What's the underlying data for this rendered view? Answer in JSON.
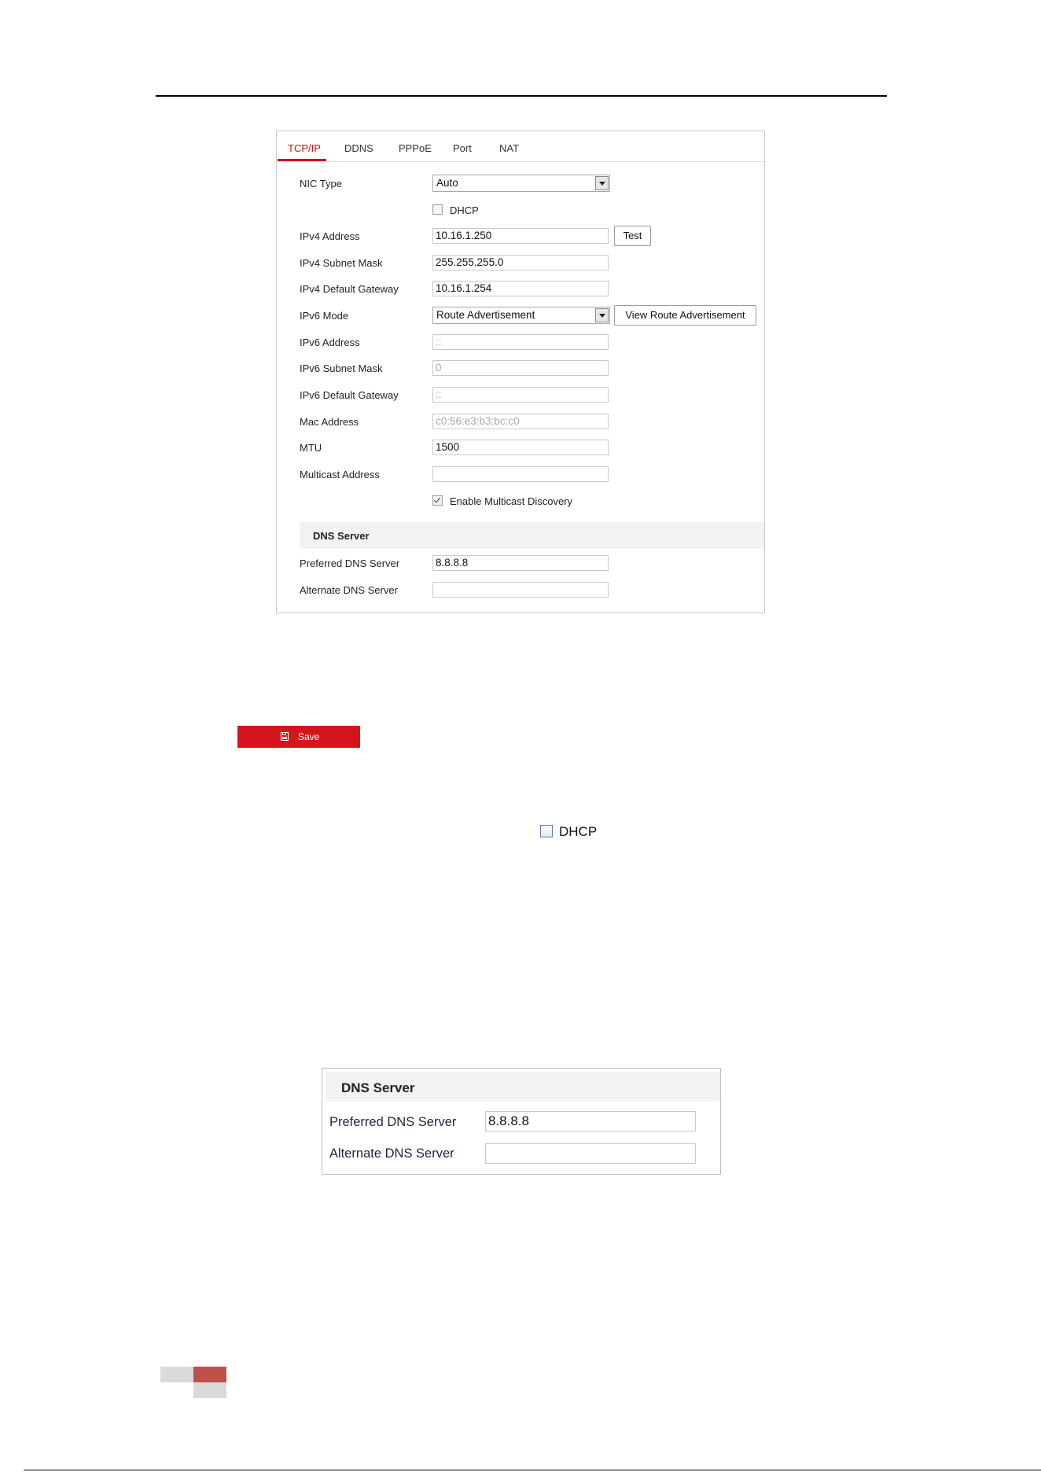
{
  "tabs": [
    "TCP/IP",
    "DDNS",
    "PPPoE",
    "Port",
    "NAT"
  ],
  "form": {
    "nic_type_label": "NIC Type",
    "nic_type_value": "Auto",
    "dhcp_label": "DHCP",
    "ipv4_address_label": "IPv4 Address",
    "ipv4_address_value": "10.16.1.250",
    "test_label": "Test",
    "ipv4_subnet_label": "IPv4 Subnet Mask",
    "ipv4_subnet_value": "255.255.255.0",
    "ipv4_gateway_label": "IPv4 Default Gateway",
    "ipv4_gateway_value": "10.16.1.254",
    "ipv6_mode_label": "IPv6 Mode",
    "ipv6_mode_value": "Route Advertisement",
    "view_route_label": "View Route Advertisement",
    "ipv6_address_label": "IPv6 Address",
    "ipv6_address_value": "::",
    "ipv6_subnet_label": "IPv6 Subnet Mask",
    "ipv6_subnet_value": "0",
    "ipv6_gateway_label": "IPv6 Default Gateway",
    "ipv6_gateway_value": "::",
    "mac_label": "Mac Address",
    "mac_value": "c0:56:e3:b3:bc:c0",
    "mtu_label": "MTU",
    "mtu_value": "1500",
    "multicast_label": "Multicast Address",
    "multicast_value": "",
    "multicast_discovery_label": "Enable Multicast Discovery",
    "dns_section_title": "DNS Server",
    "preferred_dns_label": "Preferred DNS Server",
    "preferred_dns_value": "8.8.8.8",
    "alternate_dns_label": "Alternate DNS Server",
    "alternate_dns_value": ""
  },
  "save_label": "Save",
  "dhcp_standalone_label": "DHCP",
  "dns_zoom": {
    "title": "DNS Server",
    "preferred_label": "Preferred DNS Server",
    "preferred_value": "8.8.8.8",
    "alternate_label": "Alternate DNS Server",
    "alternate_value": ""
  },
  "colors": {
    "accent": "#c4161c",
    "save_bg": "#d5151c",
    "footer_red": "#c0504d",
    "footer_grey": "#d9d9d9"
  }
}
